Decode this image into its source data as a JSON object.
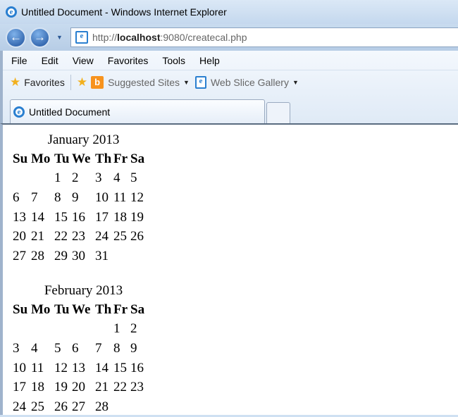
{
  "window": {
    "title": "Untitled Document - Windows Internet Explorer"
  },
  "nav": {
    "back": "back",
    "forward": "forward",
    "address_prefix": "http://",
    "address_host": "localhost",
    "address_rest": ":9080/createcal.php"
  },
  "menu": [
    "File",
    "Edit",
    "View",
    "Favorites",
    "Tools",
    "Help"
  ],
  "favorites": {
    "label": "Favorites",
    "suggested": "Suggested Sites",
    "webslice": "Web Slice Gallery"
  },
  "tab": {
    "label": "Untitled Document"
  },
  "weekdays": [
    "Su",
    "Mo",
    "Tu",
    "We",
    "Th",
    "Fr",
    "Sa"
  ],
  "months": [
    {
      "title": "January 2013",
      "weeks": [
        [
          "",
          "",
          "1",
          "2",
          "3",
          "4",
          "5"
        ],
        [
          "6",
          "7",
          "8",
          "9",
          "10",
          "11",
          "12"
        ],
        [
          "13",
          "14",
          "15",
          "16",
          "17",
          "18",
          "19"
        ],
        [
          "20",
          "21",
          "22",
          "23",
          "24",
          "25",
          "26"
        ],
        [
          "27",
          "28",
          "29",
          "30",
          "31",
          "",
          ""
        ]
      ]
    },
    {
      "title": "February 2013",
      "weeks": [
        [
          "",
          "",
          "",
          "",
          "",
          "1",
          "2"
        ],
        [
          "3",
          "4",
          "5",
          "6",
          "7",
          "8",
          "9"
        ],
        [
          "10",
          "11",
          "12",
          "13",
          "14",
          "15",
          "16"
        ],
        [
          "17",
          "18",
          "19",
          "20",
          "21",
          "22",
          "23"
        ],
        [
          "24",
          "25",
          "26",
          "27",
          "28",
          "",
          ""
        ]
      ]
    }
  ]
}
